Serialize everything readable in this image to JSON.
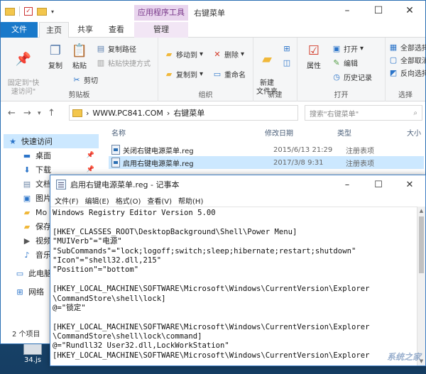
{
  "explorer": {
    "title": "右键菜单",
    "context_tab_header": "应用程序工具",
    "tabs": {
      "file": "文件",
      "home": "主页",
      "share": "共享",
      "view": "查看",
      "manage": "管理"
    },
    "ribbon": {
      "clipboard": {
        "label": "剪贴板",
        "pin": "固定到\"快\n速访问\"",
        "copy": "复制",
        "paste": "粘贴",
        "copy_path": "复制路径",
        "paste_shortcut": "粘贴快捷方式",
        "cut": "剪切"
      },
      "organize": {
        "label": "组织",
        "move_to": "移动到",
        "copy_to": "复制到",
        "delete": "删除",
        "rename": "重命名"
      },
      "new": {
        "label": "新建",
        "new_folder": "新建\n文件夹"
      },
      "open": {
        "label": "打开",
        "properties": "属性",
        "open": "打开",
        "edit": "编辑",
        "history": "历史记录"
      },
      "select": {
        "label": "选择",
        "select_all": "全部选择",
        "select_none": "全部取消",
        "invert": "反向选择"
      }
    },
    "address": {
      "path_root": "WWW.PC841.COM",
      "path_sep": "›",
      "path_leaf": "右键菜单",
      "search_placeholder": "搜索\"右键菜单\""
    },
    "nav": {
      "quick_access": "快速访问",
      "items": [
        "桌面",
        "下载",
        "文档",
        "图片",
        "Mo",
        "保存",
        "视频",
        "音乐"
      ],
      "this_pc": "此电脑",
      "network": "网络"
    },
    "columns": {
      "name": "名称",
      "date": "修改日期",
      "type": "类型",
      "size": "大小"
    },
    "files": [
      {
        "name": "关闭右键电源菜单.reg",
        "date": "2015/6/13 21:29",
        "type": "注册表项"
      },
      {
        "name": "启用右键电源菜单.reg",
        "date": "2017/3/8 9:31",
        "type": "注册表项"
      }
    ],
    "status": "2 个项目"
  },
  "notepad": {
    "title": "启用右键电源菜单.reg - 记事本",
    "menu": [
      "文件(F)",
      "编辑(E)",
      "格式(O)",
      "查看(V)",
      "帮助(H)"
    ],
    "lines": [
      "Windows Registry Editor Version 5.00",
      "",
      "[HKEY_CLASSES_ROOT\\DesktopBackground\\Shell\\Power Menu]",
      "\"MUIVerb\"=\"电源\"",
      "\"SubCommands\"=\"lock;logoff;switch;sleep;hibernate;restart;shutdown\"",
      "\"Icon\"=\"shell32.dll,215\"",
      "\"Position\"=\"bottom\"",
      "",
      "[HKEY_LOCAL_MACHINE\\SOFTWARE\\Microsoft\\Windows\\CurrentVersion\\Explorer",
      "\\CommandStore\\shell\\lock]",
      "@=\"锁定\"",
      "",
      "[HKEY_LOCAL_MACHINE\\SOFTWARE\\Microsoft\\Windows\\CurrentVersion\\Explorer",
      "\\CommandStore\\shell\\lock\\command]",
      "@=\"Rundll32 User32.dll,LockWorkStation\"",
      "[HKEY_LOCAL_MACHINE\\SOFTWARE\\Microsoft\\Windows\\CurrentVersion\\Explorer"
    ]
  },
  "desktop": {
    "icon_label": "34.js"
  },
  "watermark": "系统之家",
  "colors": {
    "accent": "#1979ca",
    "selection": "#cce8ff",
    "context_tab": "#e9d5ee"
  }
}
